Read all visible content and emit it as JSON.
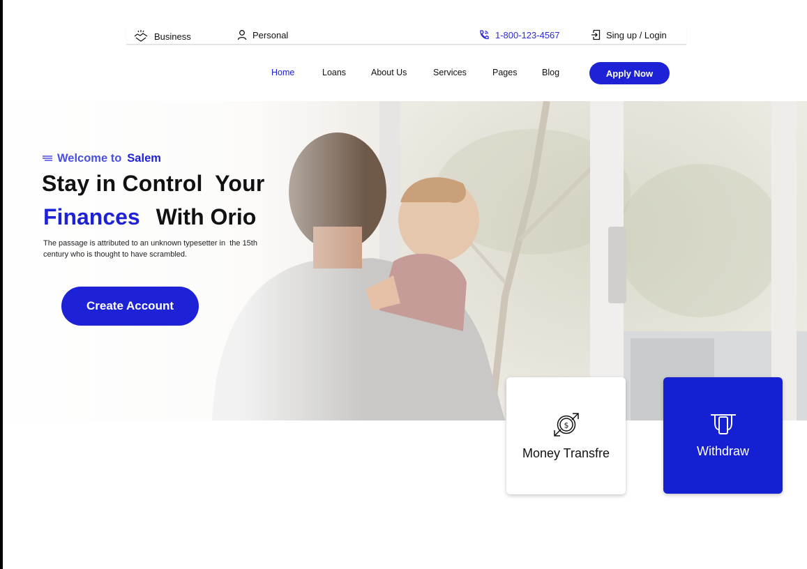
{
  "topbar": {
    "business_label": "Business",
    "personal_label": "Personal",
    "phone": "1-800-123-4567",
    "signin_label": "Sing up / Login"
  },
  "nav": {
    "items": [
      "Home",
      "Loans",
      "About Us",
      "Services",
      "Pages",
      "Blog"
    ],
    "active": "Home",
    "apply_label": "Apply Now"
  },
  "hero": {
    "welcome_prefix": "Welcome to",
    "welcome_brand": "Salem",
    "headline_line1": "Stay in Control  Your",
    "headline_highlight": "Finances",
    "headline_rest": "With Orio",
    "paragraph": "The passage is attributed to an unknown typesetter in  the 15th century who is thought to have scrambled.",
    "cta_label": "Create Account"
  },
  "cards": [
    {
      "label": "Money Transfre",
      "icon": "money-transfer-icon"
    },
    {
      "label": "Withdraw",
      "icon": "atm-withdraw-icon"
    }
  ],
  "colors": {
    "accent": "#1e22d6",
    "accent_light": "#4a4fe0"
  }
}
